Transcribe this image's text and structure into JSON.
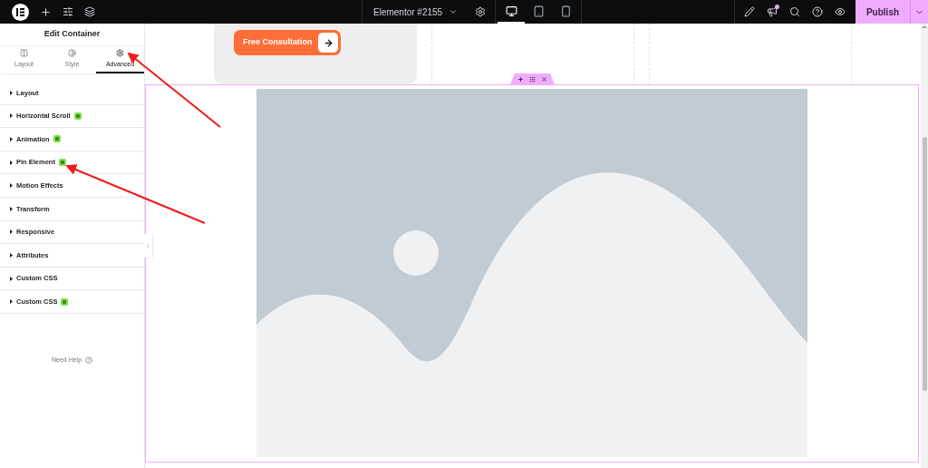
{
  "top_bar": {
    "document_title": "Elementor #2155",
    "devices": [
      {
        "kind": "desktop",
        "selected": true
      },
      {
        "kind": "tablet",
        "selected": false
      },
      {
        "kind": "mobile",
        "selected": false
      }
    ],
    "publish": "Publish"
  },
  "panel": {
    "title": "Edit Container",
    "tabs": [
      {
        "kind": "layout",
        "label": "Layout",
        "selected": false
      },
      {
        "kind": "style",
        "label": "Style",
        "selected": false
      },
      {
        "kind": "advanced",
        "label": "Advanced",
        "selected": true
      }
    ],
    "sections": [
      {
        "label": "Layout",
        "pro": false
      },
      {
        "label": "Horizontal Scroll",
        "pro": true
      },
      {
        "label": "Animation",
        "pro": true
      },
      {
        "label": "Pin Element",
        "pro": true
      },
      {
        "label": "Motion Effects",
        "pro": false
      },
      {
        "label": "Transform",
        "pro": false
      },
      {
        "label": "Responsive",
        "pro": false
      },
      {
        "label": "Attributes",
        "pro": false
      },
      {
        "label": "Custom CSS",
        "pro": false
      },
      {
        "label": "Custom CSS",
        "pro": true
      }
    ],
    "help": "Need Help"
  },
  "canvas": {
    "button": "Free Consultation"
  }
}
